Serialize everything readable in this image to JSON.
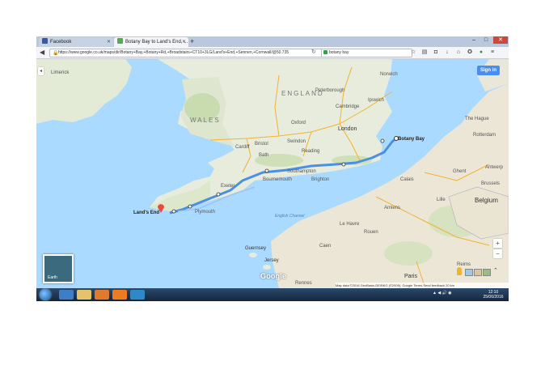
{
  "browser": {
    "tabs": [
      {
        "title": "Facebook"
      },
      {
        "title": "Botany Bay to Land's End, ..."
      }
    ],
    "new_tab_label": "+",
    "address": "https://www.google.co.uk/maps/dir/Botany+Bay,+Botany+Rd,+Broadstairs+CT10+3LG/Land's+End,+Sennen,+Cornwall/@50.735",
    "search_value": "botany bay",
    "window_buttons": {
      "minimize": "–",
      "maximize": "□",
      "close": "✕"
    }
  },
  "map": {
    "sign_in": "Sign in",
    "route_start": "Botany Bay",
    "route_end": "Land's End",
    "earth_label": "Earth",
    "country_labels": [
      "WALES",
      "ENGLAND",
      "Belgium"
    ],
    "place_labels": [
      "Limerick",
      "Cardiff",
      "Bristol",
      "Swindon",
      "London",
      "Reading",
      "Bath",
      "Norwich",
      "Ipswich",
      "Cambridge",
      "Peterborough",
      "Oxford",
      "Southampton",
      "Brighton",
      "Bournemouth",
      "Exeter",
      "Plymouth",
      "Guernsey",
      "Jersey",
      "Caen",
      "Rouen",
      "Paris",
      "Amiens",
      "Lille",
      "Brussels",
      "Antwerp",
      "Ghent",
      "The Hague",
      "Rotterdam",
      "Le Havre",
      "Calais",
      "Reims",
      "Rennes"
    ],
    "sea_label": "English Channel",
    "zoom_in": "+",
    "zoom_out": "−",
    "logo": "Google",
    "footer": "Map data ©2016 GeoBasis-DE/BKG (©2009), Google   Terms   Send feedback   20 km"
  },
  "taskbar": {
    "time": "12:10",
    "date": "25/06/2016"
  },
  "colors": {
    "route": "#4a90e2",
    "sea": "#aadaff",
    "land": "#e8ecdc",
    "sign_in": "#4a8df0",
    "marker": "#e84a3c"
  },
  "icons": [
    "facebook-icon",
    "maps-icon",
    "back-icon",
    "lock-icon",
    "reload-icon",
    "search-icon",
    "star-icon",
    "download-icon",
    "home-icon",
    "menu-icon",
    "pegman-icon",
    "windows-start-icon"
  ]
}
